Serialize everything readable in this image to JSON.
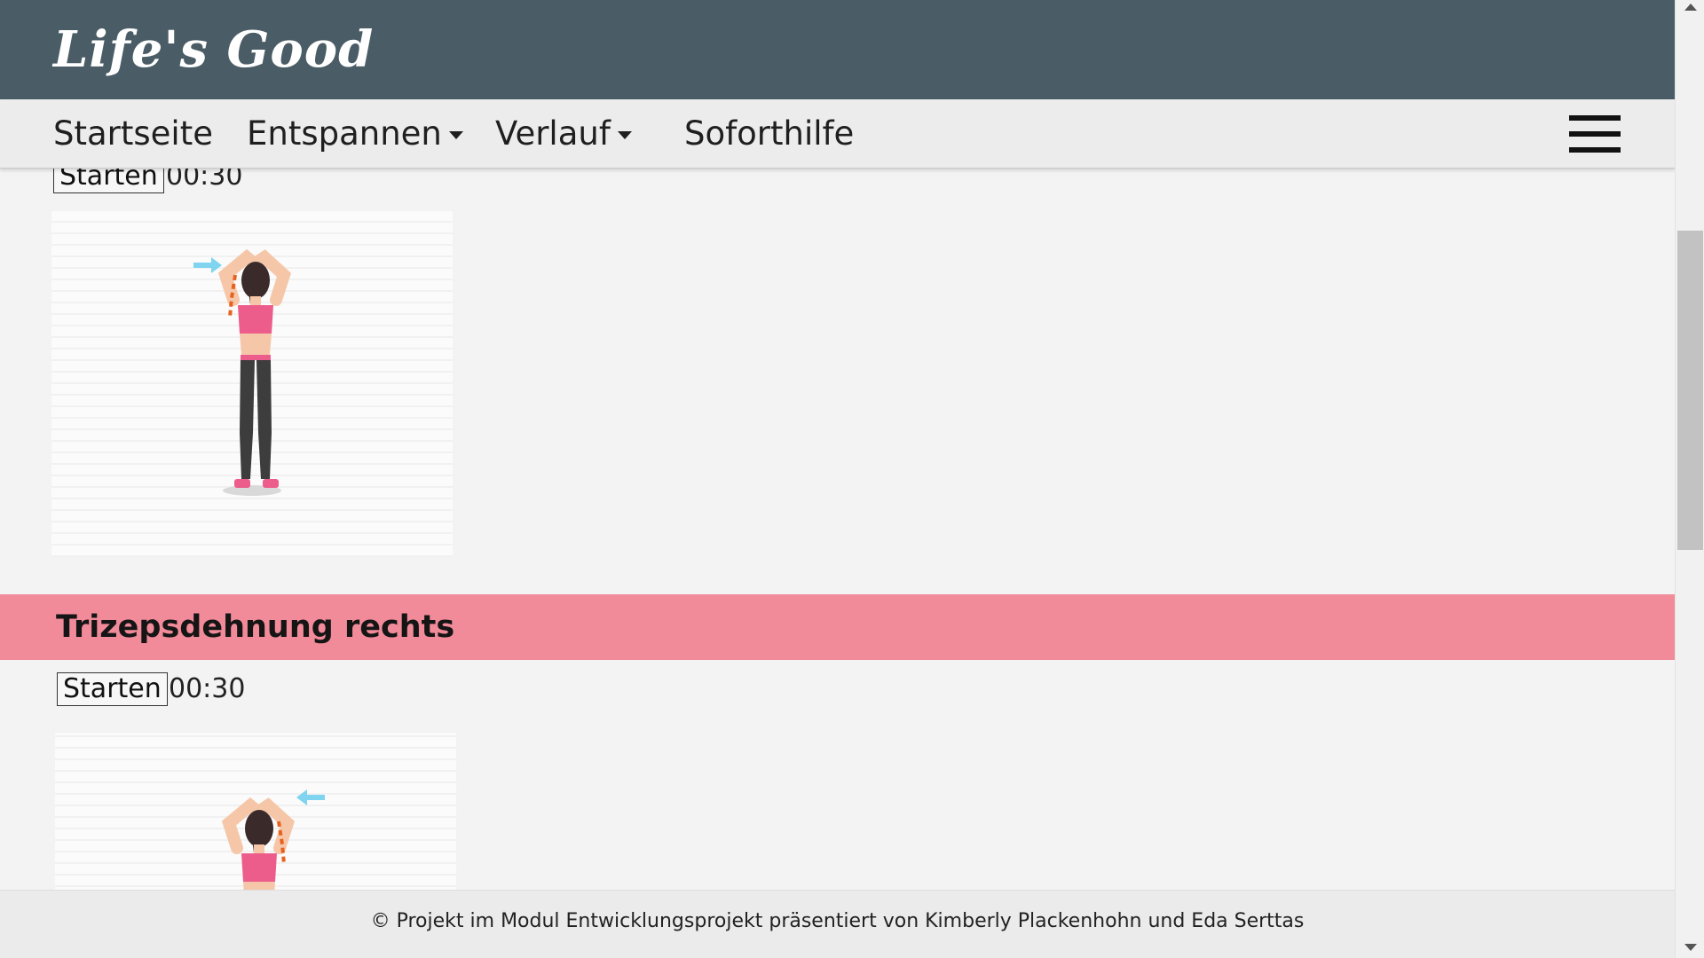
{
  "app": {
    "logo_text": "Life's Good"
  },
  "nav": {
    "items": [
      {
        "label": "Startseite"
      },
      {
        "label": "Entspannen"
      },
      {
        "label": "Verlauf"
      },
      {
        "label": "Soforthilfe"
      }
    ],
    "menu_icon": "hamburger-menu-icon"
  },
  "exercises": [
    {
      "title": "",
      "start_label": "Starten",
      "timer": "00:30",
      "image": "triceps-stretch-left-illustration",
      "arrow_direction": "right"
    },
    {
      "title": "Trizepsdehnung rechts",
      "start_label": "Starten",
      "timer": "00:30",
      "image": "triceps-stretch-right-illustration",
      "arrow_direction": "left"
    }
  ],
  "footer": {
    "text": "© Projekt im Modul Entwicklungsprojekt präsentiert von Kimberly Plackenhohn und Eda Serttas"
  },
  "colors": {
    "header_bg": "#4a5c66",
    "nav_bg": "#ececec",
    "section_bar": "#f28b99",
    "page_bg": "#f3f3f3",
    "footer_bg": "#ebebeb"
  }
}
